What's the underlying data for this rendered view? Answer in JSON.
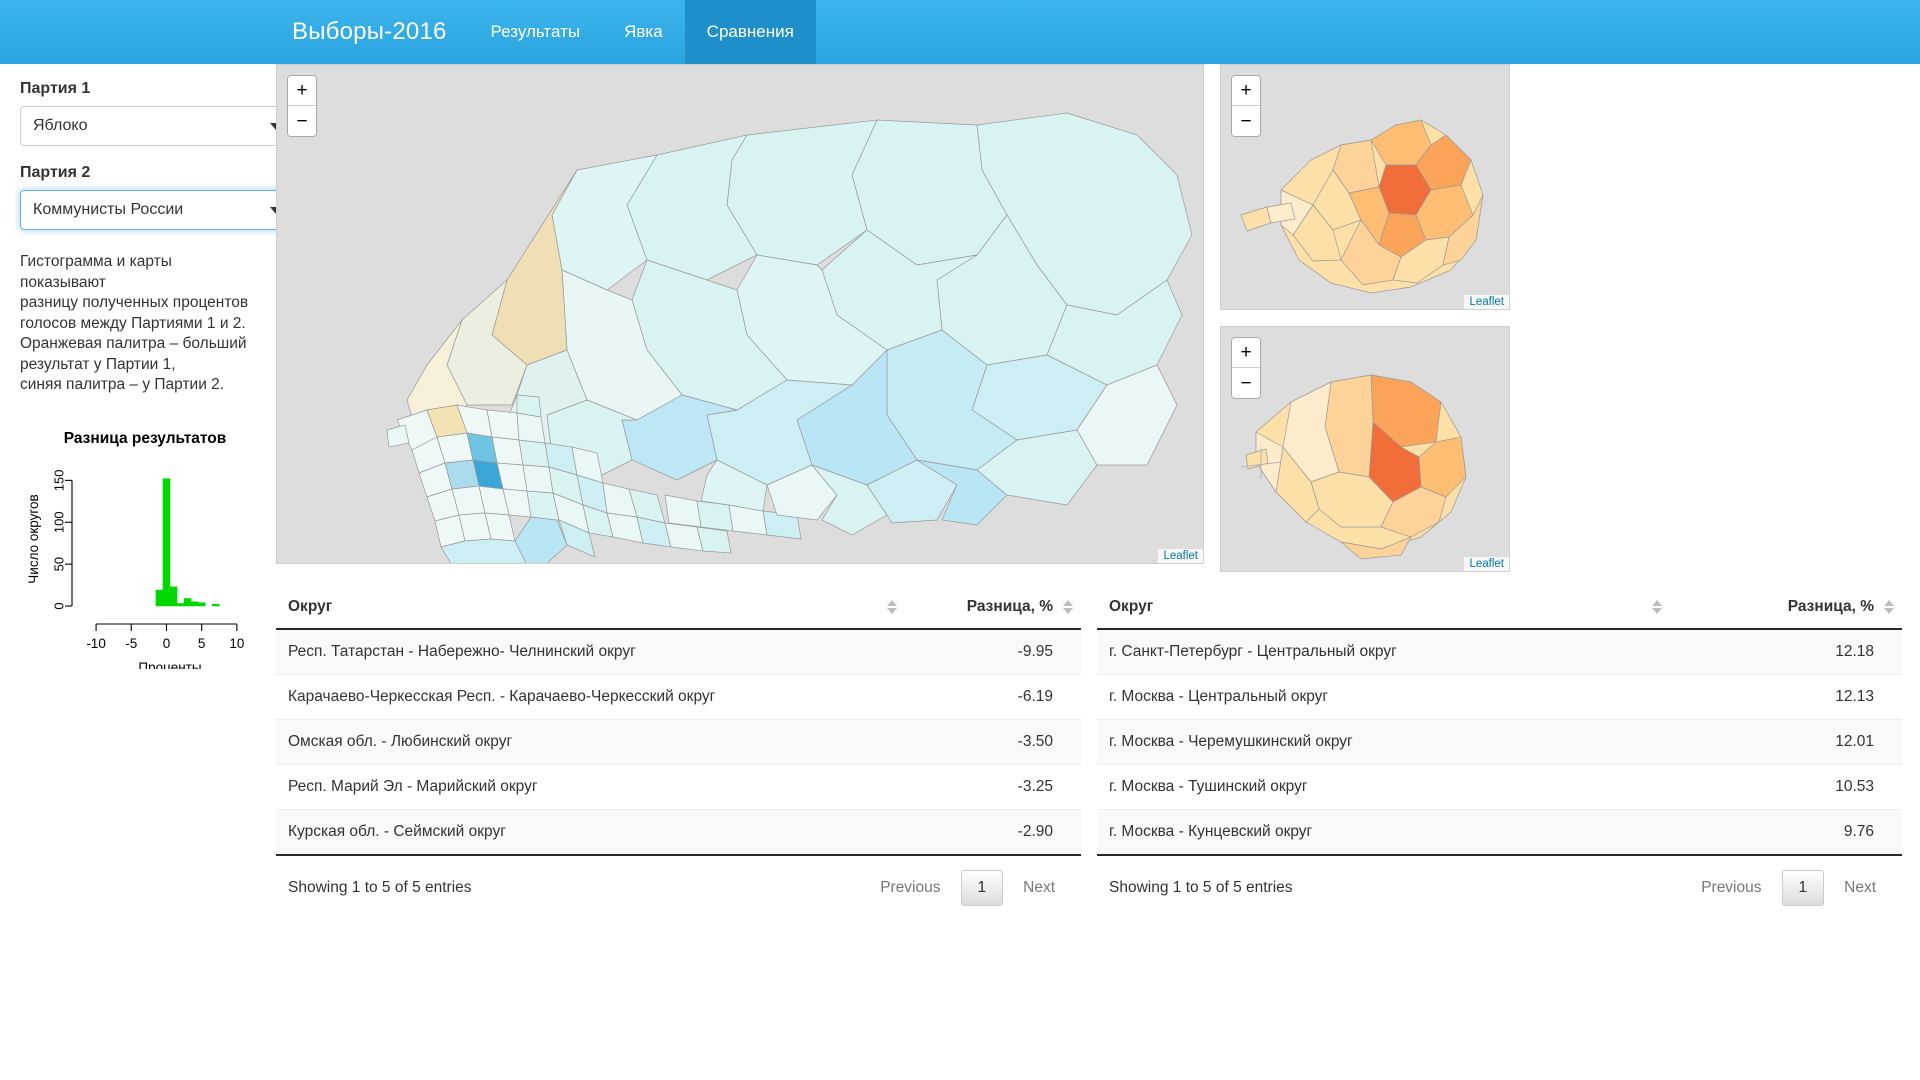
{
  "navbar": {
    "brand": "Выборы-2016",
    "items": [
      {
        "label": "Результаты",
        "active": false
      },
      {
        "label": "Явка",
        "active": false
      },
      {
        "label": "Сравнения",
        "active": true
      }
    ]
  },
  "sidebar": {
    "party1_label": "Партия 1",
    "party1_value": "Яблоко",
    "party2_label": "Партия 2",
    "party2_value": "Коммунисты России",
    "description": "Гистограмма и карты показывают\nразницу полученных процентов\nголосов между Партиями 1 и 2.\nОранжевая палитра – больший\nрезультат у Партии 1,\nсиняя палитра – у Партии 2."
  },
  "chart_data": {
    "type": "bar",
    "title": "Разница результатов",
    "xlabel": "Проценты",
    "ylabel": "Число округов",
    "categories": [
      "-3",
      "-2",
      "-1",
      "0",
      "1",
      "2",
      "3",
      "4",
      "5",
      "6",
      "7",
      "8",
      "9",
      "10",
      "11",
      "12"
    ],
    "x": [
      -3,
      -2,
      -1,
      0,
      1,
      2,
      3,
      4,
      5,
      6,
      7,
      8,
      9,
      10,
      11,
      12
    ],
    "values": [
      0,
      0,
      19,
      152,
      23,
      3,
      9,
      5,
      4,
      0,
      2,
      0,
      0,
      0,
      0,
      0
    ],
    "bin_width": 1,
    "xlim": [
      -12,
      13
    ],
    "ylim": [
      0,
      160
    ],
    "xticks": [
      -10,
      -5,
      0,
      5,
      10
    ],
    "yticks": [
      0,
      50,
      100,
      150
    ],
    "bar_color": "#00d800",
    "grid": false,
    "legend": false
  },
  "maps": {
    "main": {
      "zoom_in": "+",
      "zoom_out": "−",
      "attribution": "Leaflet"
    },
    "inset_moscow": {
      "zoom_in": "+",
      "zoom_out": "−",
      "attribution": "Leaflet"
    },
    "inset_spb": {
      "zoom_in": "+",
      "zoom_out": "−",
      "attribution": "Leaflet"
    }
  },
  "table_left": {
    "columns": [
      "Округ",
      "Разница, %"
    ],
    "rows": [
      {
        "district": "Респ. Татарстан - Набережно- Челнинский округ",
        "diff": "-9.95"
      },
      {
        "district": "Карачаево-Черкесская Респ. - Карачаево-Черкесский округ",
        "diff": "-6.19"
      },
      {
        "district": "Омская обл. - Любинский округ",
        "diff": "-3.50"
      },
      {
        "district": "Респ. Марий Эл - Марийский округ",
        "diff": "-3.25"
      },
      {
        "district": "Курская обл. - Сеймский округ",
        "diff": "-2.90"
      }
    ],
    "info": "Showing 1 to 5 of 5 entries",
    "previous": "Previous",
    "page": "1",
    "next": "Next"
  },
  "table_right": {
    "columns": [
      "Округ",
      "Разница, %"
    ],
    "rows": [
      {
        "district": "г. Санкт-Петербург - Центральный округ",
        "diff": "12.18"
      },
      {
        "district": "г. Москва - Центральный округ",
        "diff": "12.13"
      },
      {
        "district": "г. Москва - Черемушкинский округ",
        "diff": "12.01"
      },
      {
        "district": "г. Москва - Тушинский округ",
        "diff": "10.53"
      },
      {
        "district": "г. Москва - Кунцевский округ",
        "diff": "9.76"
      }
    ],
    "info": "Showing 1 to 5 of 5 entries",
    "previous": "Previous",
    "page": "1",
    "next": "Next"
  },
  "colors": {
    "navbar": "#2aa4e0",
    "navbar_active": "#1f8fc9",
    "map_background": "#dddddd",
    "histogram_bar": "#00d800",
    "focus_ring": "#66afe9"
  }
}
